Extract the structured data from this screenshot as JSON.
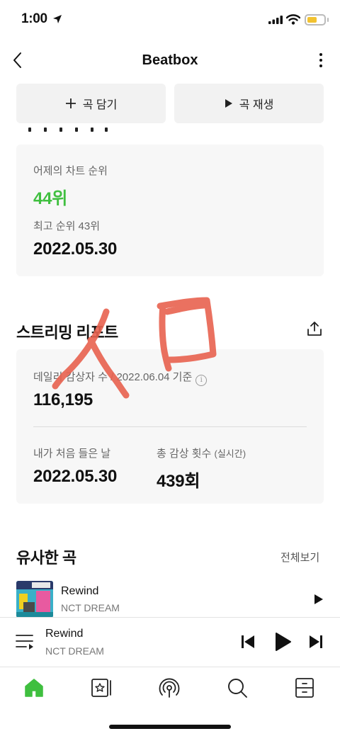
{
  "status_bar": {
    "time": "1:00"
  },
  "header": {
    "title": "Beatbox"
  },
  "actions": {
    "add_label": "곡 담기",
    "play_label": "곡 재생"
  },
  "rank_card": {
    "yesterday_label": "어제의 차트 순위",
    "yesterday_rank": "44위",
    "best_label": "최고 순위 43위",
    "best_date": "2022.05.30"
  },
  "streaming_report": {
    "title": "스트리밍 리포트",
    "daily_label": "데일리 감상자 수 / 2022.06.04 기준",
    "daily_value": "116,195",
    "first_listen_label": "내가 처음 들은 날",
    "first_listen_date": "2022.05.30",
    "total_plays_label": "총 감상 횟수",
    "total_plays_note": "(실시간)",
    "total_plays_value": "439회"
  },
  "similar": {
    "title": "유사한 곡",
    "see_all": "전체보기",
    "songs": [
      {
        "title": "Rewind",
        "artist": "NCT DREAM"
      }
    ]
  },
  "mini_player": {
    "title": "Rewind",
    "artist": "NCT DREAM"
  },
  "tab_bar": {
    "active_tab": "home-icon",
    "icons": [
      "home-icon",
      "library-icon",
      "podcast-icon",
      "search-icon",
      "storage-icon"
    ]
  },
  "colors": {
    "accent_green": "#3fbf3f",
    "scribble": "#e8624f",
    "card_bg": "#f7f7f7"
  }
}
